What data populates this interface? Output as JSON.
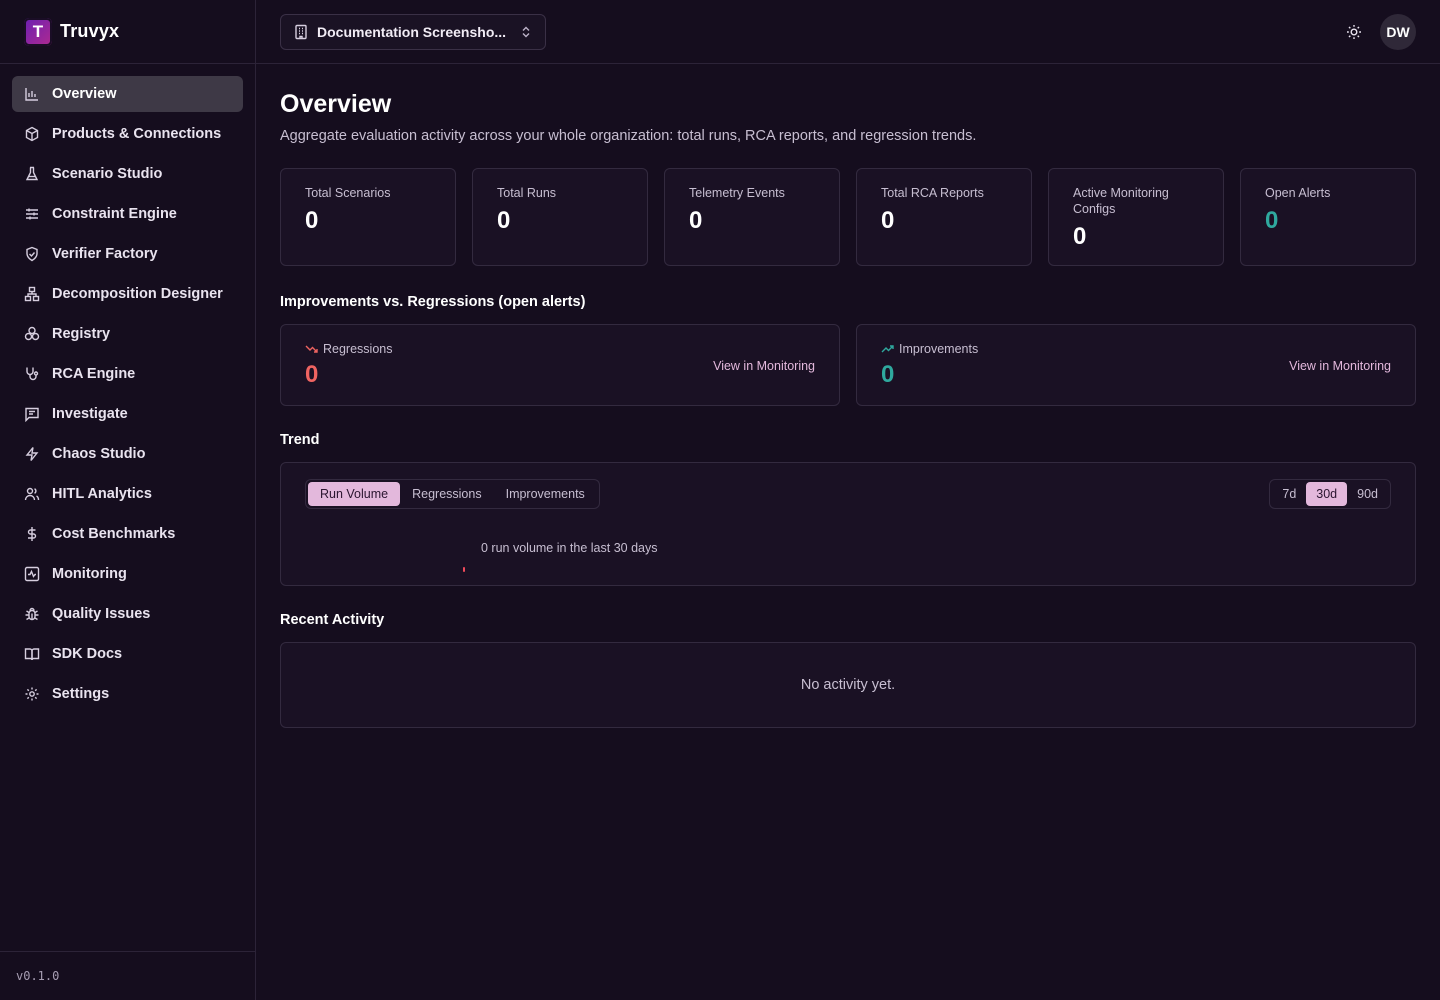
{
  "app": {
    "name": "Truvyx",
    "logo_letter": "T",
    "version": "v0.1.0"
  },
  "sidebar": {
    "items": [
      {
        "label": "Overview",
        "icon": "bar-chart-icon",
        "active": true
      },
      {
        "label": "Products & Connections",
        "icon": "box-icon"
      },
      {
        "label": "Scenario Studio",
        "icon": "flask-icon"
      },
      {
        "label": "Constraint Engine",
        "icon": "sliders-icon"
      },
      {
        "label": "Verifier Factory",
        "icon": "shield-check-icon"
      },
      {
        "label": "Decomposition Designer",
        "icon": "network-icon"
      },
      {
        "label": "Registry",
        "icon": "boxes-icon"
      },
      {
        "label": "RCA Engine",
        "icon": "stethoscope-icon"
      },
      {
        "label": "Investigate",
        "icon": "message-square-icon"
      },
      {
        "label": "Chaos Studio",
        "icon": "zap-icon"
      },
      {
        "label": "HITL Analytics",
        "icon": "users-icon"
      },
      {
        "label": "Cost Benchmarks",
        "icon": "dollar-icon"
      },
      {
        "label": "Monitoring",
        "icon": "activity-square-icon"
      },
      {
        "label": "Quality Issues",
        "icon": "bug-icon"
      },
      {
        "label": "SDK Docs",
        "icon": "book-open-icon"
      },
      {
        "label": "Settings",
        "icon": "gear-icon"
      }
    ]
  },
  "topbar": {
    "org_name": "Documentation Screensho...",
    "avatar_initials": "DW"
  },
  "page": {
    "title": "Overview",
    "subtitle": "Aggregate evaluation activity across your whole organization: total runs, RCA reports, and regression trends."
  },
  "stats": [
    {
      "label": "Total Scenarios",
      "value": "0"
    },
    {
      "label": "Total Runs",
      "value": "0"
    },
    {
      "label": "Telemetry Events",
      "value": "0"
    },
    {
      "label": "Total RCA Reports",
      "value": "0"
    },
    {
      "label": "Active Monitoring Configs",
      "value": "0"
    },
    {
      "label": "Open Alerts",
      "value": "0"
    }
  ],
  "improvements": {
    "title": "Improvements vs. Regressions (open alerts)",
    "regressions": {
      "label": "Regressions",
      "value": "0",
      "link": "View in Monitoring"
    },
    "improvements": {
      "label": "Improvements",
      "value": "0",
      "link": "View in Monitoring"
    }
  },
  "trend": {
    "title": "Trend",
    "tabs": [
      "Run Volume",
      "Regressions",
      "Improvements"
    ],
    "active_tab": "Run Volume",
    "ranges": [
      "7d",
      "30d",
      "90d"
    ],
    "active_range": "30d",
    "empty_text": "0 run volume in the last 30 days"
  },
  "activity": {
    "title": "Recent Activity",
    "empty_text": "No activity yet."
  },
  "colors": {
    "accent": "#e3b8dc",
    "regression": "#ef6461",
    "improvement": "#2fa99e",
    "background": "#150d1e"
  }
}
